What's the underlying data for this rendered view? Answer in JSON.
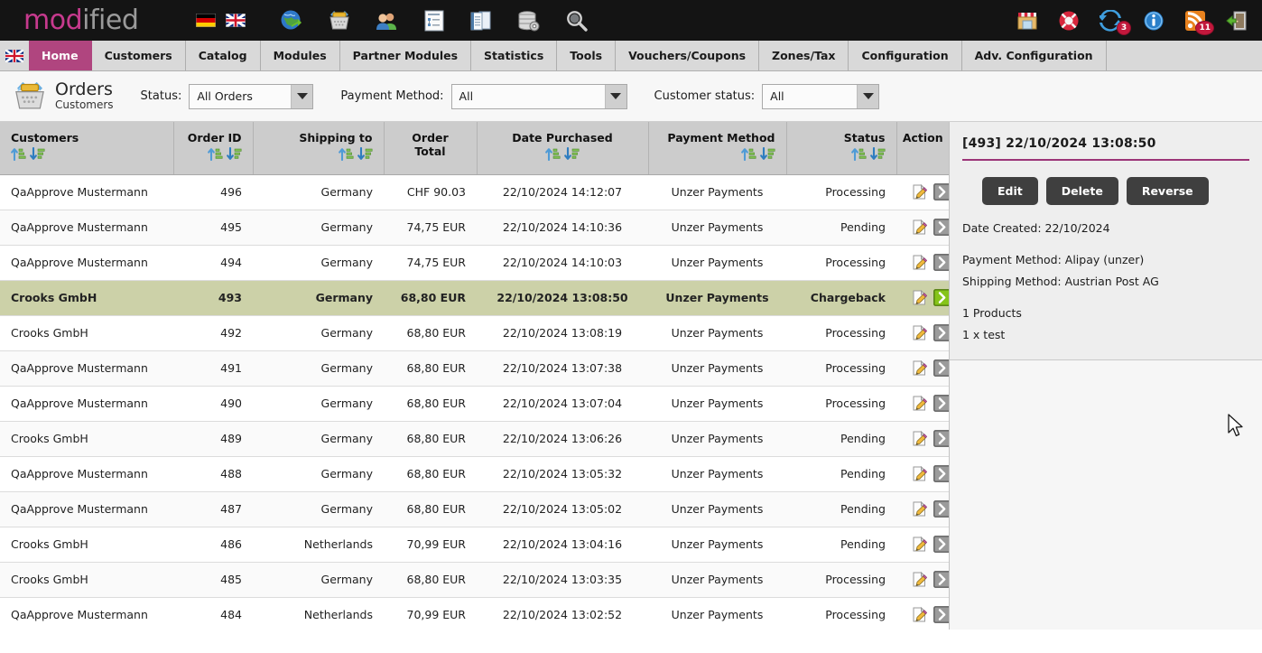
{
  "brand": {
    "name_part1": "mod",
    "name_part2": "ified"
  },
  "topbar": {
    "flags": [
      {
        "name": "german-flag-icon",
        "label": "Deutsch"
      },
      {
        "name": "english-flag-icon",
        "label": "English"
      }
    ],
    "icons": [
      {
        "name": "globe-shop-icon",
        "label": "Go to shop"
      },
      {
        "name": "basket-orders-icon",
        "label": "Orders"
      },
      {
        "name": "customers-icon",
        "label": "Customers"
      },
      {
        "name": "catalog-icon",
        "label": "Catalog"
      },
      {
        "name": "modules-icon",
        "label": "Modules"
      },
      {
        "name": "database-icon",
        "label": "Database"
      },
      {
        "name": "search-icon",
        "label": "Search"
      }
    ],
    "right_icons": [
      {
        "name": "shop-front-icon",
        "label": "Shop",
        "badge": ""
      },
      {
        "name": "lifebuoy-support-icon",
        "label": "Support",
        "badge": ""
      },
      {
        "name": "update-sync-icon",
        "label": "Updates",
        "badge": "3"
      },
      {
        "name": "info-icon",
        "label": "Info",
        "badge": ""
      },
      {
        "name": "rss-feed-icon",
        "label": "News",
        "badge": "11"
      },
      {
        "name": "logout-icon",
        "label": "Logout",
        "badge": ""
      }
    ]
  },
  "menu": {
    "flag_icon": "uk-flag-icon",
    "items": [
      {
        "label": "Home",
        "active": true
      },
      {
        "label": "Customers",
        "active": false
      },
      {
        "label": "Catalog",
        "active": false
      },
      {
        "label": "Modules",
        "active": false
      },
      {
        "label": "Partner Modules",
        "active": false
      },
      {
        "label": "Statistics",
        "active": false
      },
      {
        "label": "Tools",
        "active": false
      },
      {
        "label": "Vouchers/Coupons",
        "active": false
      },
      {
        "label": "Zones/Tax",
        "active": false
      },
      {
        "label": "Configuration",
        "active": false
      },
      {
        "label": "Adv. Configuration",
        "active": false
      }
    ]
  },
  "page": {
    "icon": "basket-icon",
    "title": "Orders",
    "subtitle": "Customers"
  },
  "filters": [
    {
      "label": "Status:",
      "value": "All Orders",
      "name": "status-select"
    },
    {
      "label": "Payment Method:",
      "value": "All",
      "name": "payment-method-select"
    },
    {
      "label": "Customer status:",
      "value": "All",
      "name": "customer-status-select"
    }
  ],
  "table": {
    "columns": [
      {
        "label": "Customers",
        "align": "l",
        "sortable": true
      },
      {
        "label": "Order ID",
        "align": "r",
        "sortable": true
      },
      {
        "label": "Shipping to",
        "align": "r",
        "sortable": true
      },
      {
        "label": "Order Total",
        "align": "r",
        "sortable": false
      },
      {
        "label": "Date Purchased",
        "align": "c",
        "sortable": true
      },
      {
        "label": "Payment Method",
        "align": "r",
        "sortable": true
      },
      {
        "label": "Status",
        "align": "r",
        "sortable": true
      },
      {
        "label": "Action",
        "align": "c",
        "sortable": false
      }
    ],
    "rows": [
      {
        "customer": "QaApprove Mustermann",
        "order_id": "496",
        "shipping_to": "Germany",
        "order_total": "CHF 90.03",
        "date_purchased": "22/10/2024 14:12:07",
        "payment_method": "Unzer Payments",
        "status": "Processing",
        "selected": false
      },
      {
        "customer": "QaApprove Mustermann",
        "order_id": "495",
        "shipping_to": "Germany",
        "order_total": "74,75 EUR",
        "date_purchased": "22/10/2024 14:10:36",
        "payment_method": "Unzer Payments",
        "status": "Pending",
        "selected": false
      },
      {
        "customer": "QaApprove Mustermann",
        "order_id": "494",
        "shipping_to": "Germany",
        "order_total": "74,75 EUR",
        "date_purchased": "22/10/2024 14:10:03",
        "payment_method": "Unzer Payments",
        "status": "Processing",
        "selected": false
      },
      {
        "customer": "Crooks GmbH",
        "order_id": "493",
        "shipping_to": "Germany",
        "order_total": "68,80 EUR",
        "date_purchased": "22/10/2024 13:08:50",
        "payment_method": "Unzer Payments",
        "status": "Chargeback",
        "selected": true
      },
      {
        "customer": "Crooks GmbH",
        "order_id": "492",
        "shipping_to": "Germany",
        "order_total": "68,80 EUR",
        "date_purchased": "22/10/2024 13:08:19",
        "payment_method": "Unzer Payments",
        "status": "Processing",
        "selected": false
      },
      {
        "customer": "QaApprove Mustermann",
        "order_id": "491",
        "shipping_to": "Germany",
        "order_total": "68,80 EUR",
        "date_purchased": "22/10/2024 13:07:38",
        "payment_method": "Unzer Payments",
        "status": "Processing",
        "selected": false
      },
      {
        "customer": "QaApprove Mustermann",
        "order_id": "490",
        "shipping_to": "Germany",
        "order_total": "68,80 EUR",
        "date_purchased": "22/10/2024 13:07:04",
        "payment_method": "Unzer Payments",
        "status": "Processing",
        "selected": false
      },
      {
        "customer": "Crooks GmbH",
        "order_id": "489",
        "shipping_to": "Germany",
        "order_total": "68,80 EUR",
        "date_purchased": "22/10/2024 13:06:26",
        "payment_method": "Unzer Payments",
        "status": "Pending",
        "selected": false
      },
      {
        "customer": "QaApprove Mustermann",
        "order_id": "488",
        "shipping_to": "Germany",
        "order_total": "68,80 EUR",
        "date_purchased": "22/10/2024 13:05:32",
        "payment_method": "Unzer Payments",
        "status": "Pending",
        "selected": false
      },
      {
        "customer": "QaApprove Mustermann",
        "order_id": "487",
        "shipping_to": "Germany",
        "order_total": "68,80 EUR",
        "date_purchased": "22/10/2024 13:05:02",
        "payment_method": "Unzer Payments",
        "status": "Pending",
        "selected": false
      },
      {
        "customer": "Crooks GmbH",
        "order_id": "486",
        "shipping_to": "Netherlands",
        "order_total": "70,99 EUR",
        "date_purchased": "22/10/2024 13:04:16",
        "payment_method": "Unzer Payments",
        "status": "Pending",
        "selected": false
      },
      {
        "customer": "Crooks GmbH",
        "order_id": "485",
        "shipping_to": "Germany",
        "order_total": "68,80 EUR",
        "date_purchased": "22/10/2024 13:03:35",
        "payment_method": "Unzer Payments",
        "status": "Processing",
        "selected": false
      },
      {
        "customer": "QaApprove Mustermann",
        "order_id": "484",
        "shipping_to": "Netherlands",
        "order_total": "70,99 EUR",
        "date_purchased": "22/10/2024 13:02:52",
        "payment_method": "Unzer Payments",
        "status": "Processing",
        "selected": false
      }
    ],
    "action_icons": {
      "edit": "edit-pencil-icon",
      "open": "open-arrow-icon"
    }
  },
  "detail": {
    "title": "[493]  22/10/2024 13:08:50",
    "buttons": [
      {
        "label": "Edit",
        "name": "edit-button"
      },
      {
        "label": "Delete",
        "name": "delete-button"
      },
      {
        "label": "Reverse",
        "name": "reverse-button"
      }
    ],
    "date_created": "Date Created: 22/10/2024",
    "payment_method": "Payment Method: Alipay (unzer)",
    "shipping_method": "Shipping Method: Austrian Post AG",
    "products_count": "1 Products",
    "product_line": "1 x test"
  },
  "colors": {
    "accent_pink": "#b0457f",
    "accent_magenta": "#c73a8e",
    "selected_row": "#ccd1a8",
    "detail_rule": "#9c3578",
    "badge_red": "#c2183c",
    "button_dark": "#3f3f3f"
  }
}
